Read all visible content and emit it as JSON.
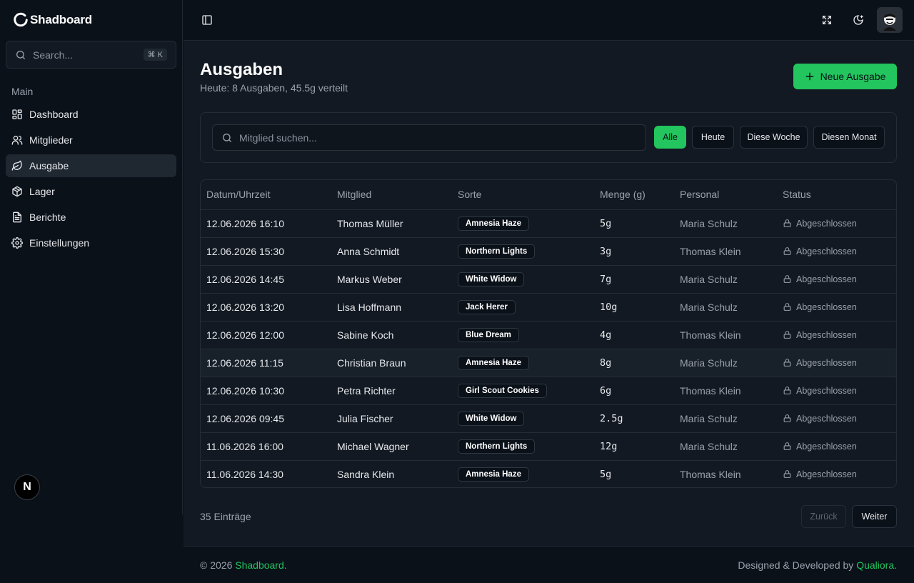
{
  "app": {
    "name": "Shadboard"
  },
  "sidebar": {
    "search_placeholder": "Search...",
    "search_shortcut": "⌘ K",
    "section_label": "Main",
    "items": [
      {
        "label": "Dashboard",
        "icon": "dashboard-icon",
        "active": false
      },
      {
        "label": "Mitglieder",
        "icon": "users-icon",
        "active": false
      },
      {
        "label": "Ausgabe",
        "icon": "leaf-icon",
        "active": true
      },
      {
        "label": "Lager",
        "icon": "package-icon",
        "active": false
      },
      {
        "label": "Berichte",
        "icon": "file-text-icon",
        "active": false
      },
      {
        "label": "Einstellungen",
        "icon": "settings-icon",
        "active": false
      }
    ],
    "badge_letter": "N"
  },
  "header": {
    "icons": [
      "sidebar-toggle-icon",
      "fullscreen-icon",
      "theme-toggle-icon",
      "user-avatar"
    ]
  },
  "page": {
    "title": "Ausgaben",
    "subtitle": "Heute: 8 Ausgaben, 45.5g verteilt",
    "new_button": "Neue Ausgabe"
  },
  "filters": {
    "search_placeholder": "Mitglied suchen...",
    "buttons": [
      "Alle",
      "Heute",
      "Diese Woche",
      "Diesen Monat"
    ],
    "active": "Alle"
  },
  "table": {
    "columns": [
      "Datum/Uhrzeit",
      "Mitglied",
      "Sorte",
      "Menge (g)",
      "Personal",
      "Status"
    ],
    "rows": [
      {
        "datetime": "12.06.2026 16:10",
        "member": "Thomas Müller",
        "strain": "Amnesia Haze",
        "amount": "5g",
        "staff": "Maria Schulz",
        "status": "Abgeschlossen"
      },
      {
        "datetime": "12.06.2026 15:30",
        "member": "Anna Schmidt",
        "strain": "Northern Lights",
        "amount": "3g",
        "staff": "Thomas Klein",
        "status": "Abgeschlossen"
      },
      {
        "datetime": "12.06.2026 14:45",
        "member": "Markus Weber",
        "strain": "White Widow",
        "amount": "7g",
        "staff": "Maria Schulz",
        "status": "Abgeschlossen"
      },
      {
        "datetime": "12.06.2026 13:20",
        "member": "Lisa Hoffmann",
        "strain": "Jack Herer",
        "amount": "10g",
        "staff": "Maria Schulz",
        "status": "Abgeschlossen"
      },
      {
        "datetime": "12.06.2026 12:00",
        "member": "Sabine Koch",
        "strain": "Blue Dream",
        "amount": "4g",
        "staff": "Thomas Klein",
        "status": "Abgeschlossen"
      },
      {
        "datetime": "12.06.2026 11:15",
        "member": "Christian Braun",
        "strain": "Amnesia Haze",
        "amount": "8g",
        "staff": "Maria Schulz",
        "status": "Abgeschlossen"
      },
      {
        "datetime": "12.06.2026 10:30",
        "member": "Petra Richter",
        "strain": "Girl Scout Cookies",
        "amount": "6g",
        "staff": "Thomas Klein",
        "status": "Abgeschlossen"
      },
      {
        "datetime": "12.06.2026 09:45",
        "member": "Julia Fischer",
        "strain": "White Widow",
        "amount": "2.5g",
        "staff": "Maria Schulz",
        "status": "Abgeschlossen"
      },
      {
        "datetime": "11.06.2026 16:00",
        "member": "Michael Wagner",
        "strain": "Northern Lights",
        "amount": "12g",
        "staff": "Maria Schulz",
        "status": "Abgeschlossen"
      },
      {
        "datetime": "11.06.2026 14:30",
        "member": "Sandra Klein",
        "strain": "Amnesia Haze",
        "amount": "5g",
        "staff": "Thomas Klein",
        "status": "Abgeschlossen"
      }
    ]
  },
  "pagination": {
    "total": "35 Einträge",
    "prev": "Zurück",
    "next": "Weiter"
  },
  "footer": {
    "copyright_prefix": "© 2026 ",
    "copyright_link": "Shadboard",
    "copyright_suffix": ".",
    "credit_prefix": "Designed & Developed by ",
    "credit_link": "Qualiora",
    "credit_suffix": "."
  },
  "colors": {
    "accent": "#22c55e",
    "background": "#0b1119",
    "surface": "#121922"
  }
}
